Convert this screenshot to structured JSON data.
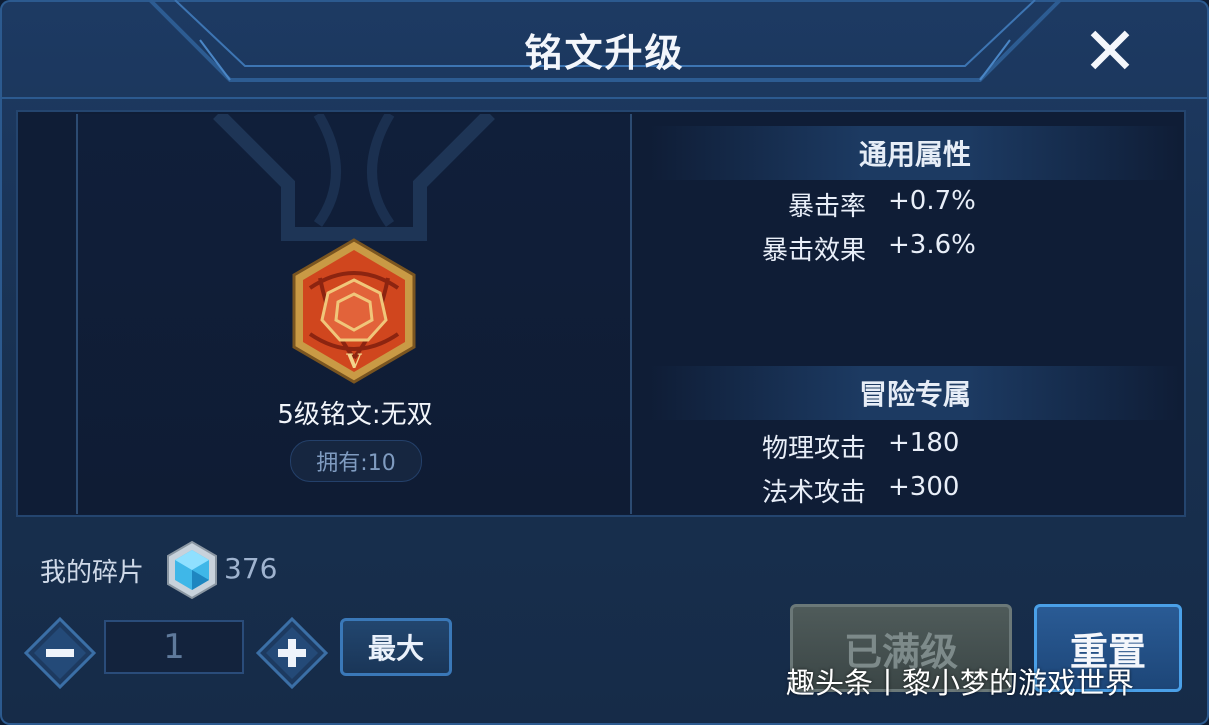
{
  "header": {
    "title": "铭文升级",
    "close_icon": "close-icon"
  },
  "rune": {
    "name": "5级铭文:无双",
    "owned": "拥有:10",
    "tier_mark": "V",
    "icon": "rune-icon",
    "color": "#d0461e"
  },
  "attributes": {
    "general": {
      "title": "通用属性",
      "rows": [
        {
          "label": "暴击率",
          "value": "+0.7%"
        },
        {
          "label": "暴击效果",
          "value": "+3.6%"
        }
      ]
    },
    "adventure": {
      "title": "冒险专属",
      "rows": [
        {
          "label": "物理攻击",
          "value": "+180"
        },
        {
          "label": "法术攻击",
          "value": "+300"
        }
      ]
    }
  },
  "shards": {
    "label": "我的碎片",
    "count": "376",
    "icon": "crystal-icon"
  },
  "quantity": {
    "value": "1",
    "minus_icon": "minus-icon",
    "plus_icon": "plus-icon"
  },
  "buttons": {
    "max": "最大",
    "maxed": "已满级",
    "reset": "重置"
  },
  "watermark": "趣头条丨黎小梦的游戏世界"
}
